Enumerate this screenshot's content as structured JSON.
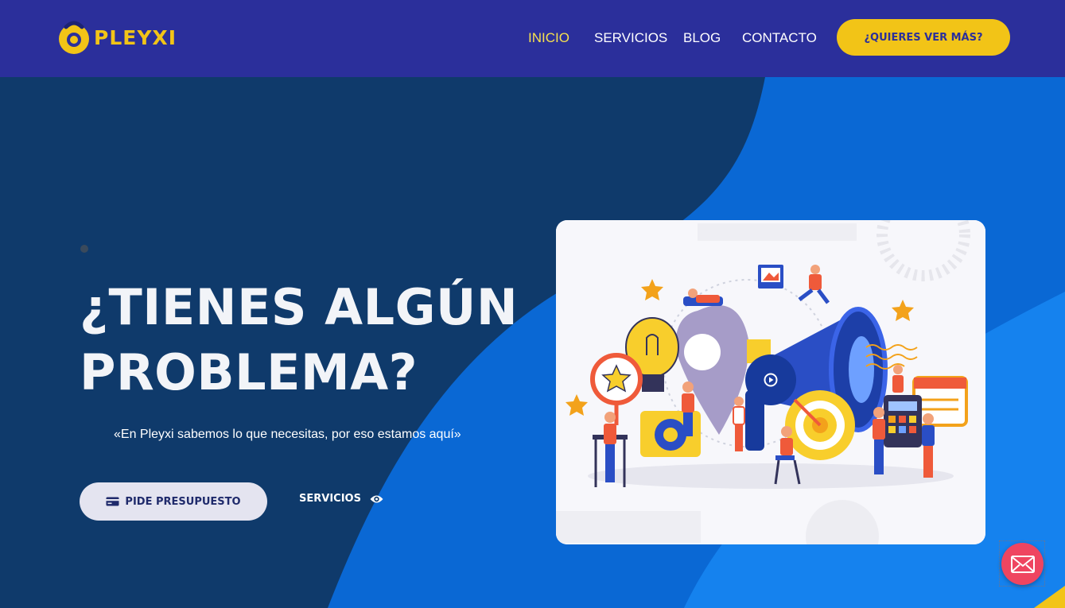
{
  "brand": {
    "name": "PLEYXI",
    "colors": {
      "header": "#2b2f9b",
      "accent": "#f2c417",
      "hero": "#0f3a6b",
      "wave": "#0a68d4",
      "mail": "#ef4560"
    }
  },
  "nav": {
    "items": [
      {
        "label": "INICIO",
        "active": true
      },
      {
        "label": "SERVICIOS",
        "active": false
      },
      {
        "label": "BLOG",
        "active": false
      },
      {
        "label": "CONTACTO",
        "active": false
      }
    ],
    "cta_label": "¿QUIERES VER MÁS?"
  },
  "hero": {
    "title_line1": "¿TIENES ALGÚN",
    "title_line2": "PROBLEMA?",
    "quote": "«En Pleyxi sabemos lo que necesitas, por eso estamos aquí»",
    "primary_button": {
      "label": "PIDE PRESUPUESTO",
      "icon": "credit-card-icon"
    },
    "secondary_button": {
      "label": "SERVICIOS",
      "icon": "eye-icon"
    }
  },
  "media": {
    "illustration": "marketing-team-megaphone-illustration",
    "play_icon": "play-icon"
  },
  "floating": {
    "icon": "mail-icon"
  }
}
